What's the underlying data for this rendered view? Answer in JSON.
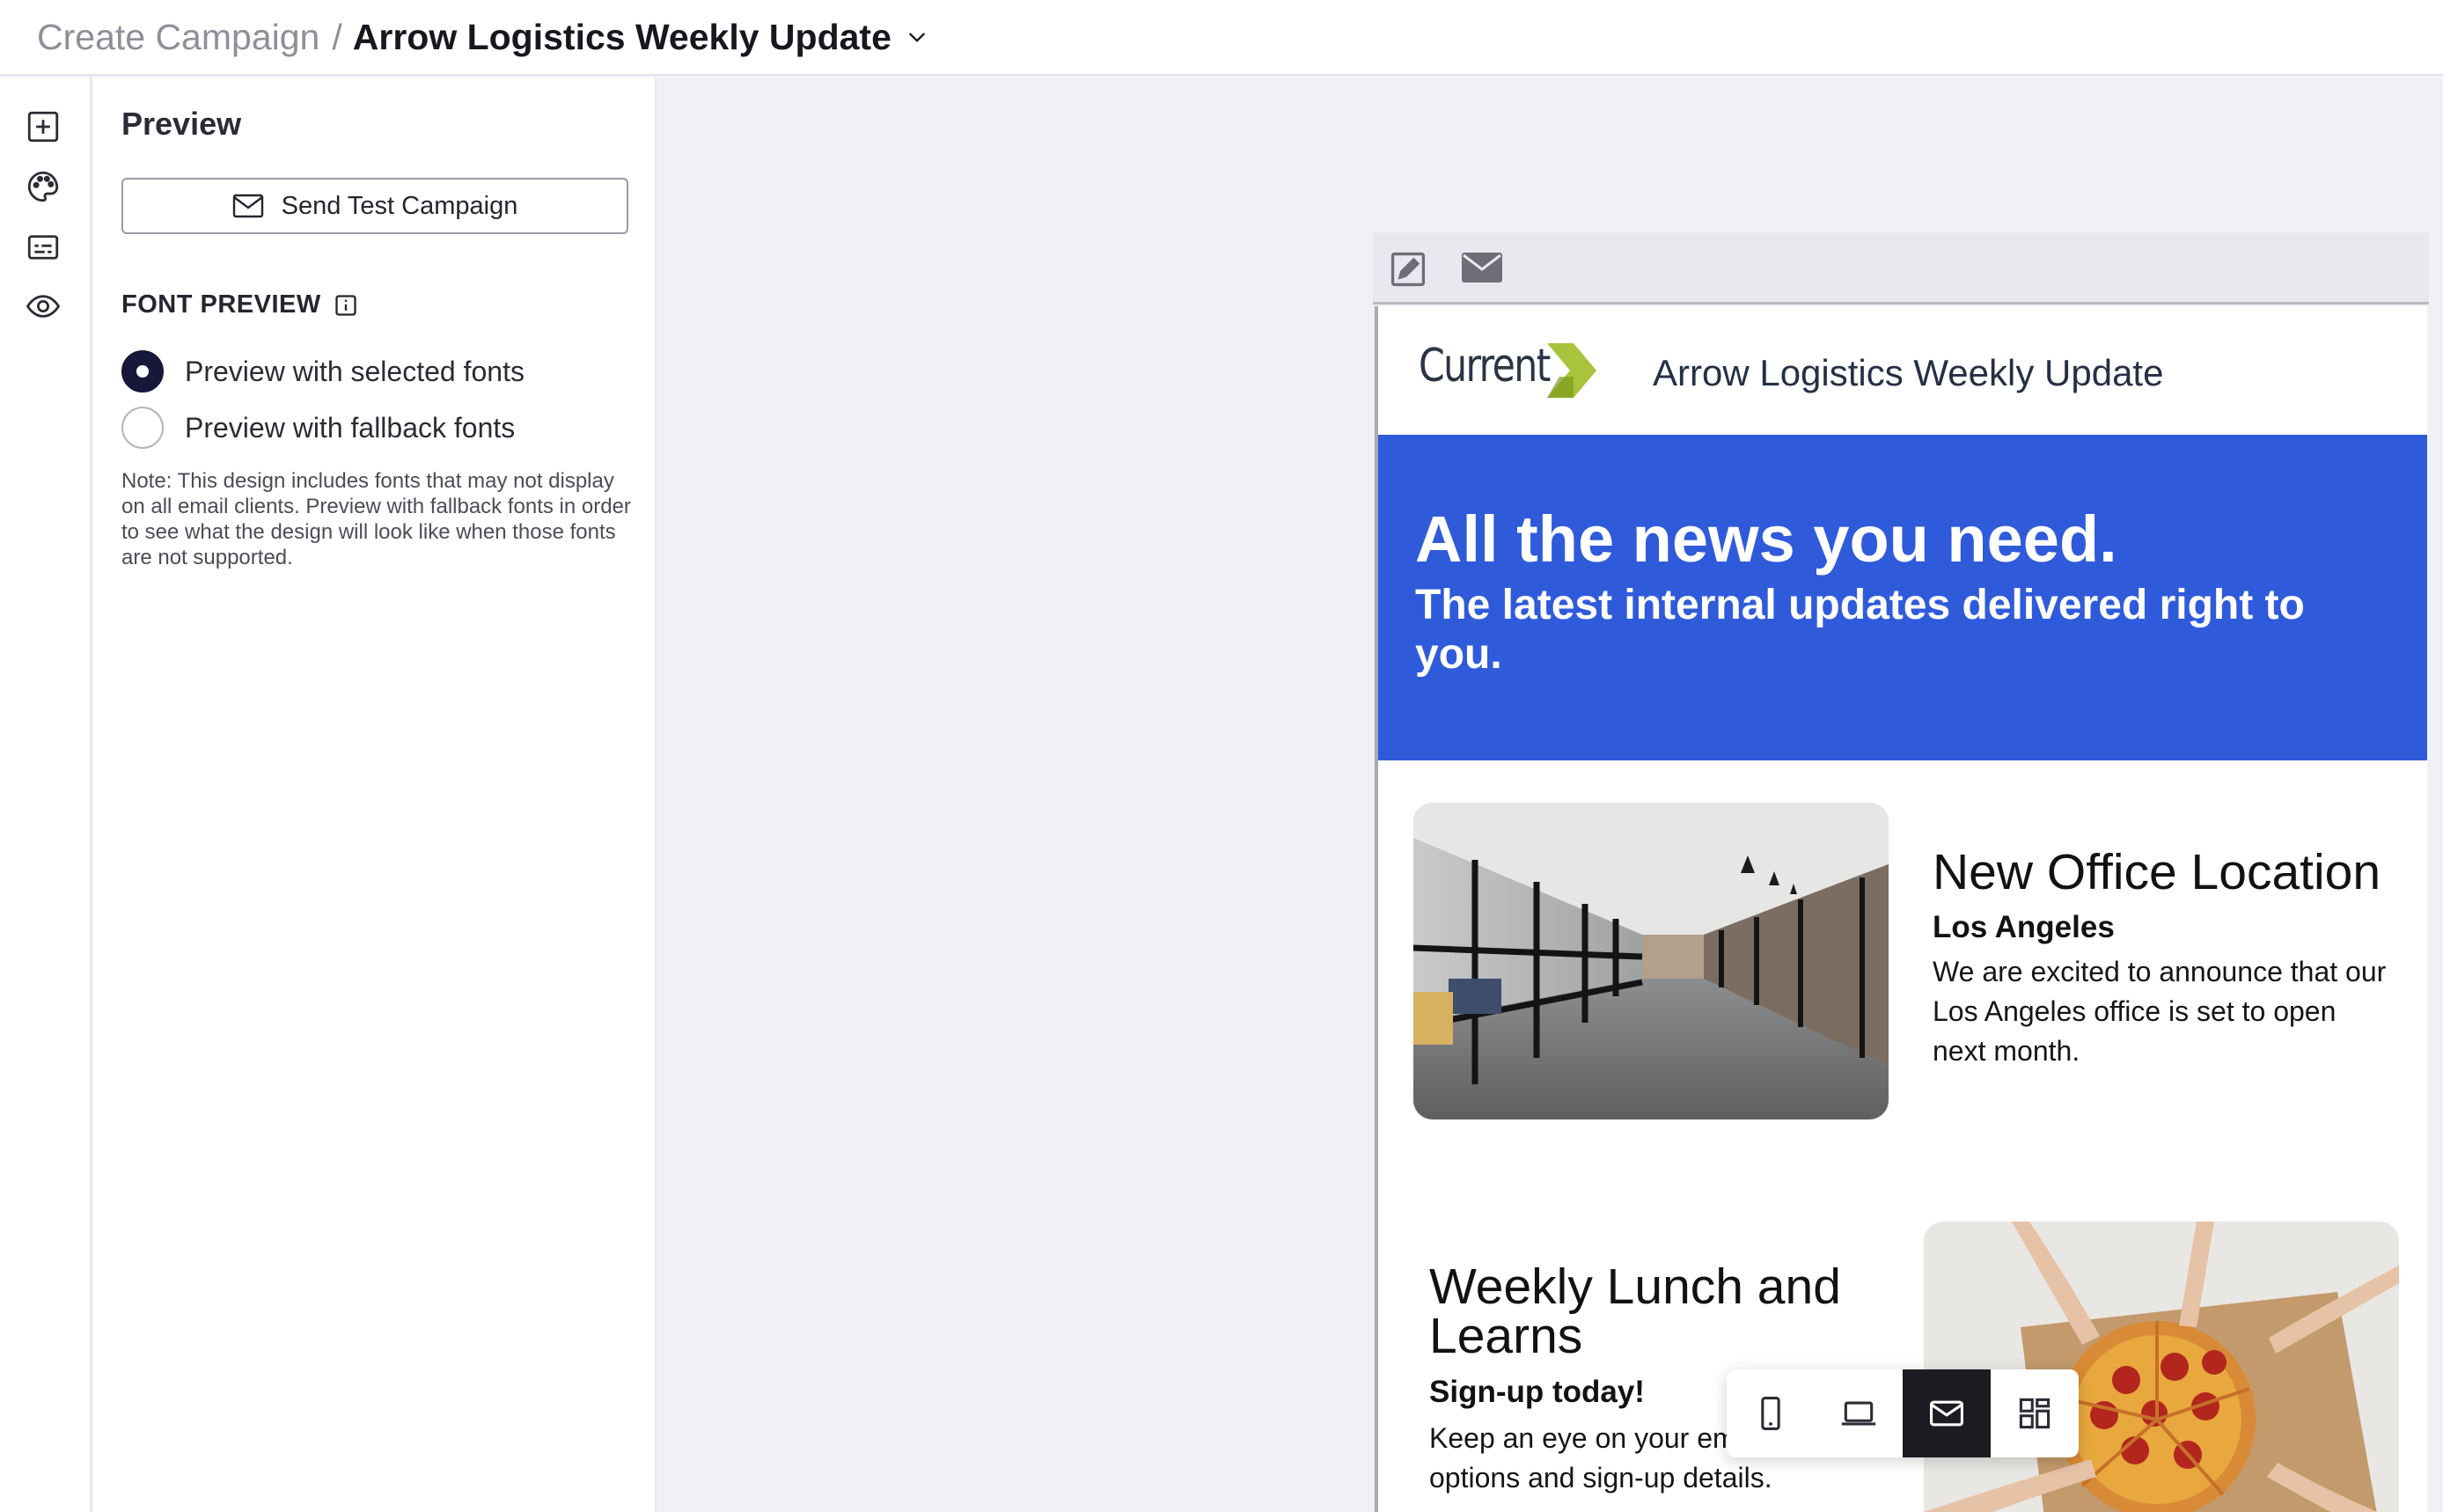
{
  "breadcrumb": {
    "parent": "Create Campaign",
    "separator": "/",
    "current": "Arrow Logistics Weekly Update"
  },
  "rail": {
    "items": [
      {
        "icon": "add-block-icon"
      },
      {
        "icon": "palette-icon"
      },
      {
        "icon": "subtitles-icon"
      },
      {
        "icon": "eye-icon"
      }
    ]
  },
  "panel": {
    "title": "Preview",
    "send_test_label": "Send Test Campaign",
    "font_preview_heading": "FONT PREVIEW",
    "options": [
      {
        "label": "Preview with selected fonts",
        "selected": true
      },
      {
        "label": "Preview with fallback fonts",
        "selected": false
      }
    ],
    "note": "Note: This design includes fonts that may not display on all email clients. Preview with fallback fonts in order to see what the design will look like when those fonts are not supported."
  },
  "email": {
    "logo_text": "Current",
    "title": "Arrow Logistics Weekly Update",
    "hero_heading": "All the news you need.",
    "hero_subheading": "The latest internal updates delivered right to you.",
    "article1": {
      "title": "New Office Location",
      "subtitle": "Los Angeles",
      "body": "We are excited to announce that our Los Angeles office is set to open next month."
    },
    "article2": {
      "title": "Weekly Lunch and Learns",
      "subtitle": "Sign-up today!",
      "body": "Keep an eye on your email for a list of options and sign-up details."
    }
  },
  "device_toggle": {
    "options": [
      "mobile",
      "laptop",
      "email",
      "grid"
    ],
    "active": "email"
  },
  "colors": {
    "hero_blue": "#2f5bdb",
    "logo_green": "#a8c43c",
    "radio_selected": "#17173a"
  }
}
